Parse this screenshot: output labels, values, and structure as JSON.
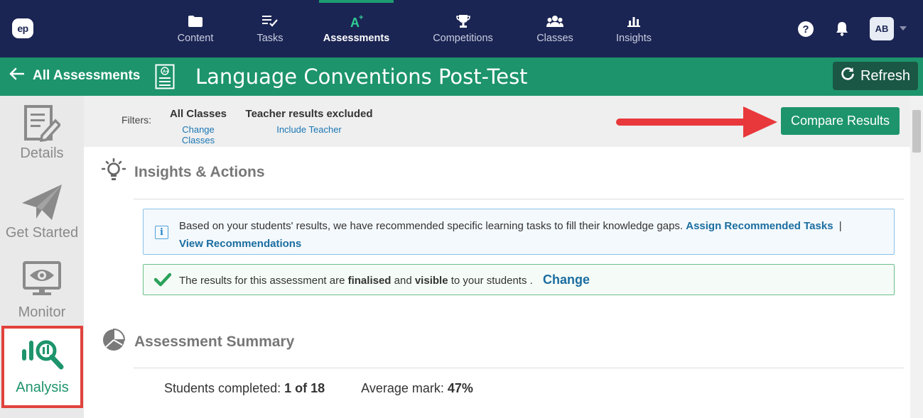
{
  "topnav": {
    "logo": "ep",
    "items": [
      {
        "label": "Content",
        "icon": "folder-icon"
      },
      {
        "label": "Tasks",
        "icon": "checklist-icon"
      },
      {
        "label": "Assessments",
        "icon": "grade-a-plus-icon",
        "active": true
      },
      {
        "label": "Competitions",
        "icon": "trophy-icon"
      },
      {
        "label": "Classes",
        "icon": "group-icon"
      },
      {
        "label": "Insights",
        "icon": "bar-chart-icon"
      }
    ],
    "help": "?",
    "avatar": "AB"
  },
  "header": {
    "back_label": "All Assessments",
    "title": "Language Conventions Post-Test",
    "refresh_label": "Refresh"
  },
  "sidebar": {
    "items": [
      {
        "label": "Details",
        "icon": "document-edit-icon"
      },
      {
        "label": "Get Started",
        "icon": "paper-plane-icon"
      },
      {
        "label": "Monitor",
        "icon": "monitor-eye-icon"
      },
      {
        "label": "Analysis",
        "icon": "analysis-magnifier-icon",
        "active": true
      }
    ]
  },
  "filters": {
    "label": "Filters:",
    "classes_value": "All Classes",
    "classes_action": "Change Classes",
    "teacher_value": "Teacher results excluded",
    "teacher_action": "Include Teacher",
    "compare_label": "Compare Results"
  },
  "insights": {
    "heading": "Insights & Actions",
    "info_text": "Based on your students' results, we have recommended specific learning tasks to fill their knowledge gaps.",
    "assign_link": "Assign Recommended Tasks",
    "separator": "|",
    "view_link": "View Recommendations",
    "status_pre": "The results for this assessment are",
    "status_finalised": "finalised",
    "status_and": "and",
    "status_visible": "visible",
    "status_post": "to your students .",
    "change_link": "Change"
  },
  "summary": {
    "heading": "Assessment Summary",
    "completed_label": "Students completed:",
    "completed_value": "1 of 18",
    "average_label": "Average mark:",
    "average_value": "47%"
  },
  "colors": {
    "nav_bg": "#1b2553",
    "brand_green": "#1d946c",
    "highlight_red": "#e0433c"
  }
}
